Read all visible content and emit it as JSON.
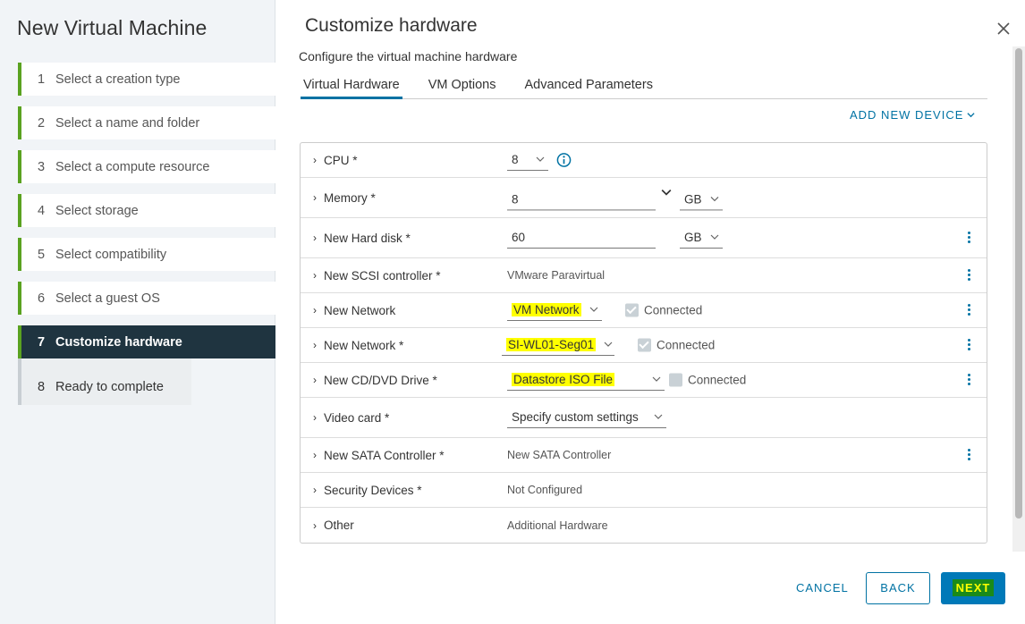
{
  "wizard": {
    "title": "New Virtual Machine",
    "steps": [
      {
        "num": "1",
        "label": "Select a creation type"
      },
      {
        "num": "2",
        "label": "Select a name and folder"
      },
      {
        "num": "3",
        "label": "Select a compute resource"
      },
      {
        "num": "4",
        "label": "Select storage"
      },
      {
        "num": "5",
        "label": "Select compatibility"
      },
      {
        "num": "6",
        "label": "Select a guest OS"
      },
      {
        "num": "7",
        "label": "Customize hardware"
      },
      {
        "num": "8",
        "label": "Ready to complete"
      }
    ],
    "active_step": "7"
  },
  "page": {
    "title": "Customize hardware",
    "subtitle": "Configure the virtual machine hardware"
  },
  "tabs": [
    {
      "label": "Virtual Hardware",
      "active": true
    },
    {
      "label": "VM Options",
      "active": false
    },
    {
      "label": "Advanced Parameters",
      "active": false
    }
  ],
  "add_device_label": "ADD NEW DEVICE",
  "hardware": {
    "cpu": {
      "label": "CPU *",
      "value": "8"
    },
    "memory": {
      "label": "Memory *",
      "value": "8",
      "unit": "GB"
    },
    "hard_disk": {
      "label": "New Hard disk *",
      "value": "60",
      "unit": "GB"
    },
    "scsi": {
      "label": "New SCSI controller *",
      "value": "VMware Paravirtual"
    },
    "network1": {
      "label": "New Network",
      "value": "VM Network",
      "connected_label": "Connected",
      "connected": true
    },
    "network2": {
      "label": "New Network *",
      "value": "SI-WL01-Seg01",
      "connected_label": "Connected",
      "connected": true
    },
    "cddvd": {
      "label": "New CD/DVD Drive *",
      "value": "Datastore ISO File",
      "connected_label": "Connected",
      "connected": false
    },
    "video": {
      "label": "Video card *",
      "value": "Specify custom settings"
    },
    "sata": {
      "label": "New SATA Controller *",
      "value": "New SATA Controller"
    },
    "security": {
      "label": "Security Devices *",
      "value": "Not Configured"
    },
    "other": {
      "label": "Other",
      "value": "Additional Hardware"
    }
  },
  "footer": {
    "cancel": "CANCEL",
    "back": "BACK",
    "next": "NEXT"
  },
  "colors": {
    "accent": "#0072a3",
    "progress": "#5aa220",
    "active_step_bg": "#1f3440",
    "highlight": "#ffff00"
  }
}
